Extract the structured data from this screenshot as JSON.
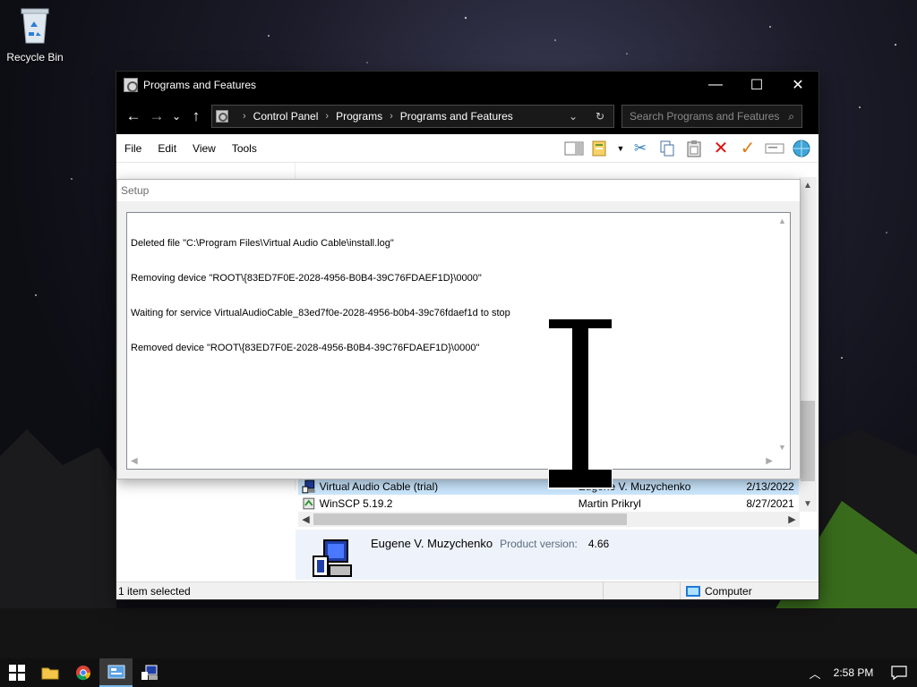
{
  "desktop": {
    "recycle_bin_label": "Recycle Bin"
  },
  "window": {
    "title": "Programs and Features",
    "minimize": "—",
    "maximize": "☐",
    "close": "✕"
  },
  "nav": {
    "back": "←",
    "forward": "→",
    "recent": "⌄",
    "up": "↑",
    "breadcrumb": [
      "Control Panel",
      "Programs",
      "Programs and Features"
    ],
    "search_placeholder": "Search Programs and Features"
  },
  "menu": [
    "File",
    "Edit",
    "View",
    "Tools"
  ],
  "programs": [
    {
      "name": "Virtual Audio Cable (trial)",
      "publisher": "Eugene V. Muzychenko",
      "date": "2/13/2022",
      "selected": true
    },
    {
      "name": "WinSCP 5.19.2",
      "publisher": "Martin Prikryl",
      "date": "8/27/2021",
      "selected": false
    }
  ],
  "details": {
    "publisher": "Eugene V. Muzychenko",
    "version_label": "Product version:",
    "version_value": "4.66"
  },
  "status": {
    "items_selected": "1 item selected",
    "location": "Computer"
  },
  "setup": {
    "title": "Setup",
    "log": [
      "Deleted file \"C:\\Program Files\\Virtual Audio Cable\\install.log\"",
      "Removing device \"ROOT\\{83ED7F0E-2028-4956-B0B4-39C76FDAEF1D}\\0000\"",
      "Waiting for service VirtualAudioCable_83ed7f0e-2028-4956-b0b4-39c76fdaef1d to stop",
      "Removed device \"ROOT\\{83ED7F0E-2028-4956-B0B4-39C76FDAEF1D}\\0000\""
    ]
  },
  "taskbar": {
    "clock": "2:58 PM"
  }
}
